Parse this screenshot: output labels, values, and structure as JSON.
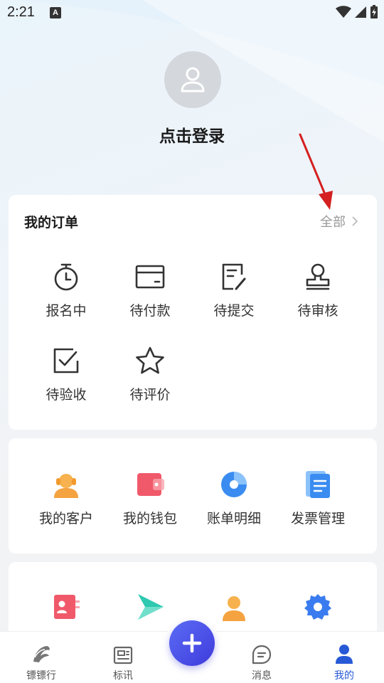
{
  "status_bar": {
    "time": "2:21",
    "notification_letter": "A"
  },
  "profile": {
    "login_label": "点击登录"
  },
  "orders": {
    "title": "我的订单",
    "all_label": "全部",
    "items": [
      {
        "label": "报名中",
        "icon": "stopwatch-icon"
      },
      {
        "label": "待付款",
        "icon": "wallet-card-icon"
      },
      {
        "label": "待提交",
        "icon": "document-edit-icon"
      },
      {
        "label": "待审核",
        "icon": "stamp-icon"
      },
      {
        "label": "待验收",
        "icon": "checkbox-icon"
      },
      {
        "label": "待评价",
        "icon": "star-icon"
      }
    ]
  },
  "services": {
    "items": [
      {
        "label": "我的客户",
        "icon": "customer-icon",
        "color": "#f4a340"
      },
      {
        "label": "我的钱包",
        "icon": "wallet-icon",
        "color": "#f0596a"
      },
      {
        "label": "账单明细",
        "icon": "pie-chart-icon",
        "color": "#3a8cf0"
      },
      {
        "label": "发票管理",
        "icon": "invoice-icon",
        "color": "#3a8cf0"
      }
    ]
  },
  "more": {
    "items": [
      {
        "icon": "id-card-icon",
        "color": "#f0596a"
      },
      {
        "icon": "send-arrow-icon",
        "color": "#2ec9b0"
      },
      {
        "icon": "person-icon",
        "color": "#f4a340"
      },
      {
        "icon": "settings-gear-icon",
        "color": "#3a7cf0"
      }
    ]
  },
  "bottom_nav": {
    "items": [
      {
        "label": "镖镖行",
        "icon": "horse-logo-icon"
      },
      {
        "label": "标讯",
        "icon": "newspaper-icon"
      },
      {
        "label": "消息",
        "icon": "message-bubble-icon"
      },
      {
        "label": "我的",
        "icon": "user-profile-icon",
        "active": true
      }
    ],
    "fab_icon": "plus-icon"
  },
  "colors": {
    "accent": "#2759d6",
    "fab": "#4a4ee8",
    "annotation": "#d42020"
  }
}
